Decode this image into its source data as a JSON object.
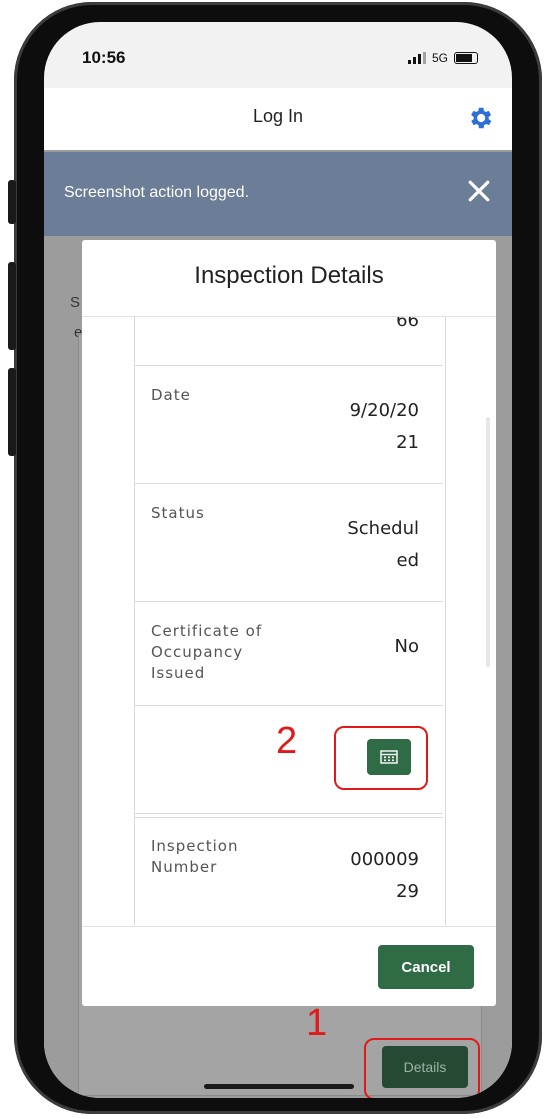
{
  "status_bar": {
    "time": "10:56",
    "network": "5G"
  },
  "nav": {
    "title": "Log In",
    "settings_icon": "gear-icon"
  },
  "background": {
    "text_s": "S",
    "text_e": "e",
    "details_label": "Details"
  },
  "toast": {
    "message": "Screenshot action logged.",
    "close_icon": "close-icon"
  },
  "modal": {
    "title": "Inspection Details",
    "rows": [
      {
        "label": "",
        "value": "66"
      },
      {
        "label": "Date",
        "value": "9/20/2021"
      },
      {
        "label": "Status",
        "value": "Scheduled"
      },
      {
        "label": "Certificate of Occupancy Issued",
        "value": "No"
      },
      {
        "label": "",
        "value": ""
      },
      {
        "label": "Inspection Number",
        "value": "00000929"
      }
    ],
    "calendar_icon": "calendar-icon",
    "cancel_label": "Cancel"
  },
  "annotations": {
    "one": "1",
    "two": "2"
  },
  "colors": {
    "primary_green": "#2f6b45",
    "toast_bg": "#6b7d97",
    "annotation_red": "#e11919",
    "gear_blue": "#2d6fd6"
  }
}
